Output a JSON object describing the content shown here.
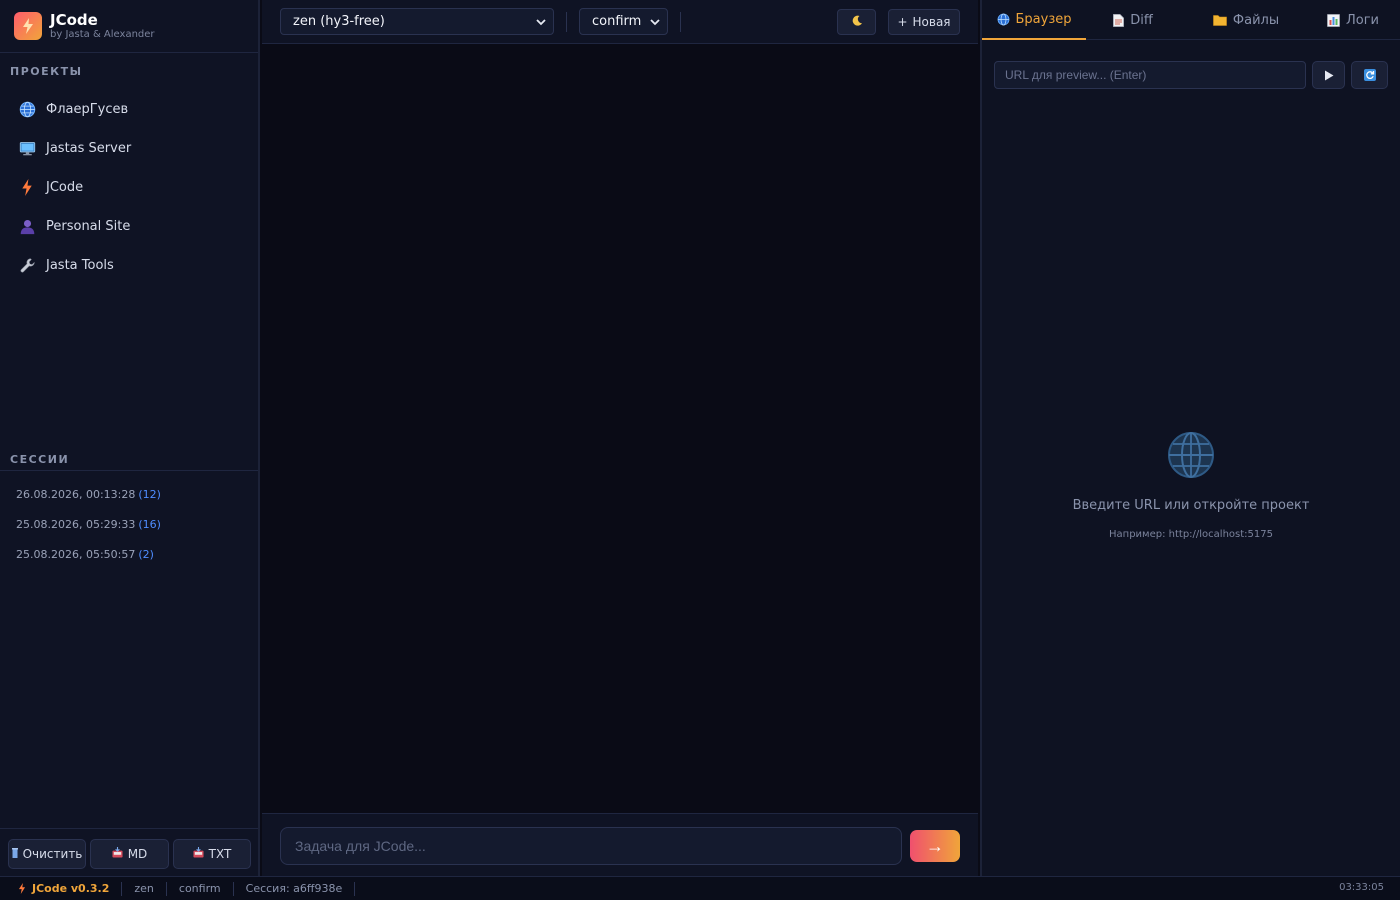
{
  "brand": {
    "name": "JCode",
    "subtitle": "by Jasta & Alexander",
    "logo_icon": "bolt-icon"
  },
  "colors": {
    "accent": "#f0a53a",
    "link": "#4f8dff",
    "gradient_start": "#f0506e",
    "gradient_end": "#f0a53a"
  },
  "sidebar": {
    "projects_title": "ПРОЕКТЫ",
    "projects": [
      {
        "label": "ФлаерГусев",
        "icon": "globe-icon"
      },
      {
        "label": "Jastas Server",
        "icon": "monitor-icon"
      },
      {
        "label": "JCode",
        "icon": "bolt-icon"
      },
      {
        "label": "Personal Site",
        "icon": "user-icon"
      },
      {
        "label": "Jasta Tools",
        "icon": "wrench-icon"
      }
    ],
    "sessions_title": "СЕССИИ",
    "sessions": [
      {
        "date": "26.08.2026, 00:13:28",
        "count": "(12)"
      },
      {
        "date": "25.08.2026, 05:29:33",
        "count": "(16)"
      },
      {
        "date": "25.08.2026, 05:50:57",
        "count": "(2)"
      }
    ],
    "buttons": {
      "clear": "Очистить",
      "md": "MD",
      "txt": "TXT"
    }
  },
  "toolbar": {
    "model_select": "zen (hy3-free)",
    "mode_select": "confirm",
    "theme_icon": "moon-icon",
    "new_label": "Новая",
    "new_prefix": "+"
  },
  "composer": {
    "placeholder": "Задача для JCode...",
    "send_label": "→"
  },
  "right_panel": {
    "tabs": [
      {
        "label": "Браузер",
        "icon": "globe-icon",
        "active": true
      },
      {
        "label": "Diff",
        "icon": "document-icon",
        "active": false
      },
      {
        "label": "Файлы",
        "icon": "folder-icon",
        "active": false
      },
      {
        "label": "Логи",
        "icon": "chart-icon",
        "active": false
      }
    ],
    "url_placeholder": "URL для preview... (Enter)",
    "empty_title": "Введите URL или откройте проект",
    "empty_hint": "Например: http://localhost:5175"
  },
  "statusbar": {
    "version": "JCode v0.3.2",
    "model": "zen",
    "mode": "confirm",
    "session": "Сессия: a6ff938e",
    "clock": "03:33:05"
  }
}
